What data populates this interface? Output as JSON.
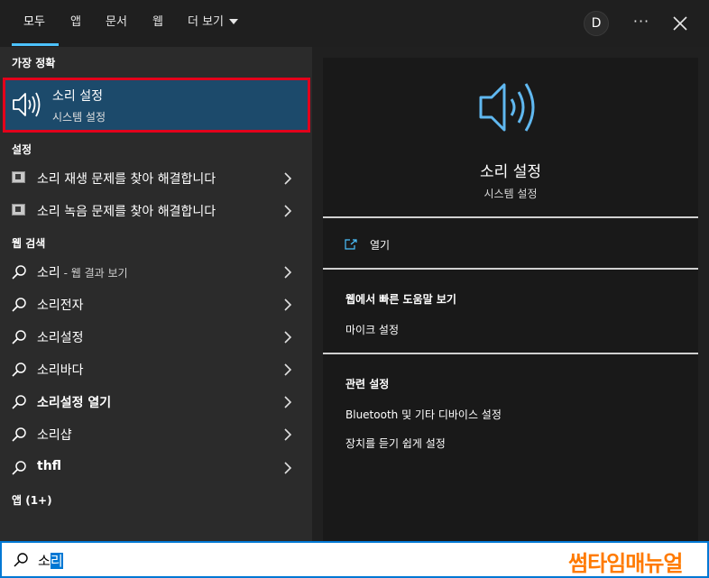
{
  "tabs": [
    {
      "label": "모두",
      "active": true
    },
    {
      "label": "앱"
    },
    {
      "label": "문서"
    },
    {
      "label": "웹"
    },
    {
      "label": "더 보기"
    }
  ],
  "account": {
    "initial": "D"
  },
  "more_options": "···",
  "left": {
    "best_match_header": "가장 정확",
    "best_match": {
      "title": "소리 설정",
      "subtitle": "시스템 설정",
      "icon": "speaker-icon"
    },
    "settings_header": "설정",
    "settings": [
      {
        "label": "소리 재생 문제를 찾아 해결합니다",
        "icon": "troubleshoot-icon"
      },
      {
        "label": "소리 녹음 문제를 찾아 해결합니다",
        "icon": "troubleshoot-icon"
      }
    ],
    "web_header": "웹 검색",
    "web": [
      {
        "label": "소리",
        "suffix": " - 웹 결과 보기"
      },
      {
        "label": "소리전자"
      },
      {
        "label": "소리설정"
      },
      {
        "label": "소리바다"
      },
      {
        "label": "소리설정 열기"
      },
      {
        "label": "소리샵"
      },
      {
        "label": "thfl"
      }
    ],
    "apps_header": "앱 (1+)"
  },
  "right": {
    "title": "소리 설정",
    "subtitle": "시스템 설정",
    "open_label": "열기",
    "web_help_header": "웹에서 빠른 도움말 보기",
    "web_help_items": [
      "마이크 설정"
    ],
    "related_header": "관련 설정",
    "related_items": [
      "Bluetooth 및 기타 디바이스 설정",
      "장치를 듣기 쉽게 설정"
    ]
  },
  "search": {
    "typed": "소",
    "selected": "리"
  },
  "watermark": "썸타임매뉴얼",
  "colors": {
    "accent": "#4cc2ff",
    "highlight_border": "#e3001b",
    "selection": "#1c4a6b",
    "watermark": "#ff7a00"
  }
}
